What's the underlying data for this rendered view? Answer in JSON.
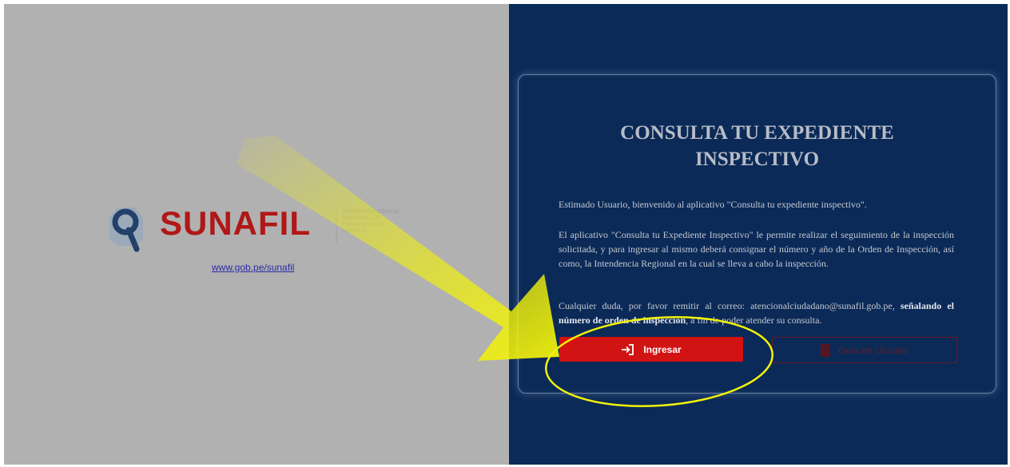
{
  "brand": {
    "logo_name": "SUNAFIL",
    "logo_subtitle": [
      "SUPERINTENDENCIA",
      "NACIONAL DE",
      "FISCALIZACIÓN",
      "LABORAL"
    ],
    "website_link": "www.gob.pe/sunafil",
    "colors": {
      "left_bg": "#b1b1b1",
      "right_bg": "#0b2a57",
      "accent_red": "#d21313",
      "highlight_yellow": "#f2f20a"
    }
  },
  "card": {
    "title_line1": "CONSULTA TU EXPEDIENTE",
    "title_line2": "INSPECTIVO",
    "paragraph1": "Estimado Usuario, bienvenido al aplicativo \"Consulta tu expediente inspectivo\".",
    "paragraph2": "El aplicativo \"Consulta tu Expediente Inspectivo\" le permite realizar el seguimiento de la inspección solicitada, y para ingresar al mismo deberá consignar el número y año de la Orden de Inspección, así como, la Intendencia Regional en la cual se lleva a cabo la inspección.",
    "paragraph3_text": "Cualquier duda, por favor remitir al correo: atencionalciudadano@sunafil.gob.pe, ",
    "paragraph3_bold": "señalando el número de orden de inspección",
    "paragraph3_end": ", a fin de poder atender su consulta."
  },
  "buttons": {
    "login_label": "Ingresar",
    "login_icon": "login-arrow-icon",
    "guide_label": "Guía de Usuario",
    "guide_icon": "pdf-document-icon"
  }
}
